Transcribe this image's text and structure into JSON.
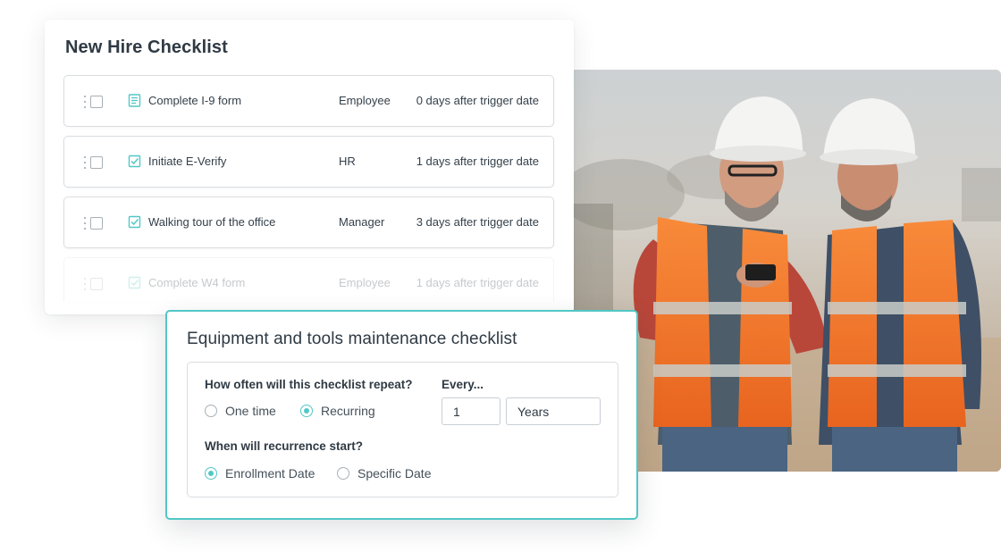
{
  "new_hire": {
    "title": "New Hire Checklist",
    "tasks": [
      {
        "name": "Complete I-9 form",
        "owner": "Employee",
        "when": "0 days after trigger date",
        "icon": "form-icon"
      },
      {
        "name": "Initiate E-Verify",
        "owner": "HR",
        "when": "1 days after trigger date",
        "icon": "checkbox-icon"
      },
      {
        "name": "Walking tour of the office",
        "owner": "Manager",
        "when": "3 days after trigger date",
        "icon": "checkbox-icon"
      },
      {
        "name": "Complete W4 form",
        "owner": "Employee",
        "when": "1 days after trigger date",
        "icon": "checkbox-icon"
      }
    ]
  },
  "equipment": {
    "title": "Equipment and tools maintenance checklist",
    "repeat_question": "How often will this checklist repeat?",
    "repeat_options": [
      {
        "label": "One time",
        "selected": false
      },
      {
        "label": "Recurring",
        "selected": true
      }
    ],
    "every_label": "Every...",
    "every_value": "1",
    "every_unit": "Years",
    "start_question": "When will recurrence start?",
    "start_options": [
      {
        "label": "Enrollment Date",
        "selected": true
      },
      {
        "label": "Specific Date",
        "selected": false
      }
    ]
  },
  "colors": {
    "accent": "#52c7c6",
    "text": "#2f3a44",
    "border": "#d9dde0",
    "vest": "#f57a2c"
  }
}
